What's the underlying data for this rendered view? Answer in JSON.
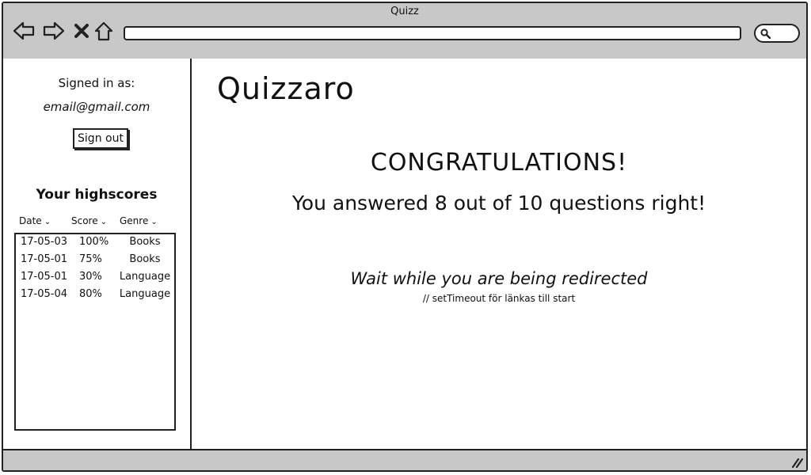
{
  "window": {
    "title": "Quizz"
  },
  "toolbar": {
    "back_icon": "back-arrow-icon",
    "forward_icon": "forward-arrow-icon",
    "close_icon": "close-x-icon",
    "home_icon": "home-icon",
    "url_value": "",
    "search_icon": "search-icon"
  },
  "sidebar": {
    "signed_in_label": "Signed in as:",
    "email": "email@gmail.com",
    "signout_label": "Sign out",
    "highscores_title": "Your highscores",
    "columns": [
      {
        "label": "Date"
      },
      {
        "label": "Score"
      },
      {
        "label": "Genre"
      }
    ],
    "rows": [
      {
        "date": "17-05-03",
        "score": "100%",
        "genre": "Books"
      },
      {
        "date": "17-05-01",
        "score": "75%",
        "genre": "Books"
      },
      {
        "date": "17-05-01",
        "score": "30%",
        "genre": "Language"
      },
      {
        "date": "17-05-04",
        "score": "80%",
        "genre": "Language"
      }
    ]
  },
  "main": {
    "brand": "Quizzaro",
    "congrats": "CONGRATULATIONS!",
    "result": "You answered 8 out of 10 questions right!",
    "wait": "Wait while you are being redirected",
    "note": "// setTimeout för länkas till start"
  },
  "colors": {
    "chrome": "#c8c8c8",
    "border": "#222222",
    "background": "#ffffff"
  }
}
